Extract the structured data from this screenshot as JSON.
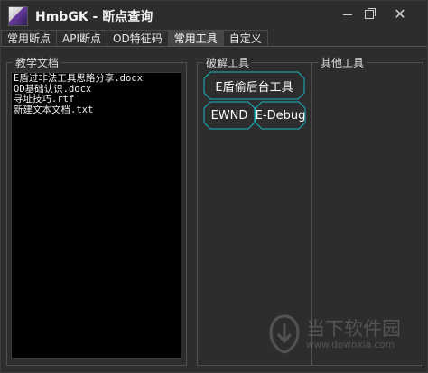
{
  "window": {
    "title": "HmbGK - 断点查询",
    "controls": {
      "minimize": "minimize-icon",
      "maximize": "restore-icon",
      "close": "close-icon"
    }
  },
  "tabs": [
    {
      "label": "常用断点",
      "active": false
    },
    {
      "label": "API断点",
      "active": false
    },
    {
      "label": "OD特征码",
      "active": false
    },
    {
      "label": "常用工具",
      "active": true
    },
    {
      "label": "自定义",
      "active": false
    }
  ],
  "groups": {
    "teaching": {
      "label": "教学文档",
      "files": [
        "E盾过非法工具思路分享.docx",
        "OD基础认识.docx",
        "寻址技巧.rtf",
        "新建文本文档.txt"
      ]
    },
    "crack": {
      "label": "破解工具",
      "buttons": {
        "e_shield": "E盾偷后台工具",
        "ewnd": "EWND",
        "edebug": "E-Debug"
      }
    },
    "other": {
      "label": "其他工具"
    }
  },
  "watermark": {
    "text": "当下软件园",
    "url": "www.downxia.com"
  },
  "colors": {
    "background": "#2d2d2d",
    "accent_border": "#19b3c4",
    "list_background": "#000000"
  }
}
